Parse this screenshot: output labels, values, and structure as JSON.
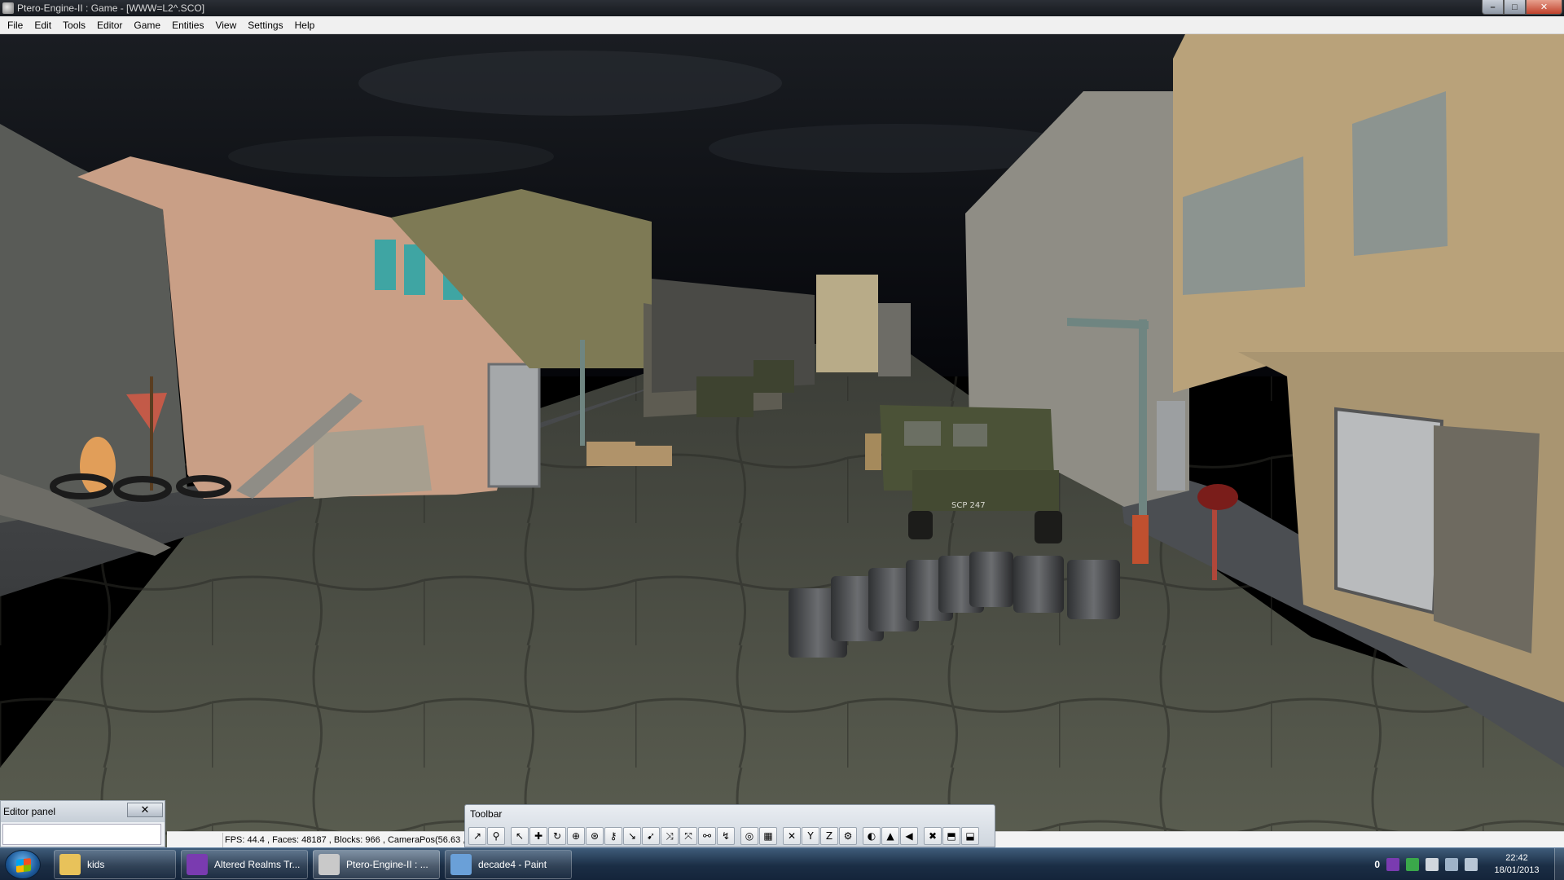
{
  "window": {
    "title": "Ptero-Engine-II : Game - [WWW=L2^.SCO]",
    "controls": {
      "minimize": "–",
      "maximize": "□",
      "close": "✕"
    }
  },
  "menu": {
    "items": [
      "File",
      "Edit",
      "Tools",
      "Editor",
      "Game",
      "Entities",
      "View",
      "Settings",
      "Help"
    ]
  },
  "editor_panel": {
    "title": "Editor panel",
    "close_label": "✕"
  },
  "toolbar": {
    "title": "Toolbar",
    "buttons": [
      "↗",
      "⚲",
      "↖",
      "✚",
      "↻",
      "⊕",
      "⊛",
      "⚷",
      "↘",
      "➹",
      "⤨",
      "⤧",
      "⚯",
      "↯",
      "◎",
      "▦",
      "✕",
      "Y",
      "Z",
      "⚙",
      "◐",
      "▲",
      "◀",
      "✖",
      "⬒",
      "⬓"
    ]
  },
  "status": {
    "text": "FPS: 44.4 , Faces: 48187 , Blocks: 966 , CameraPos(56.63 ,"
  },
  "viewport": {
    "truck_plate": "SCP 247"
  },
  "taskbar": {
    "items": [
      {
        "label": "kids",
        "icon": "folder-icon",
        "color": "#e8c25a"
      },
      {
        "label": "Altered Realms Tr...",
        "icon": "altered-realms-icon",
        "color": "#7a3bb0"
      },
      {
        "label": "Ptero-Engine-II : ...",
        "icon": "ptero-engine-icon",
        "color": "#c9c9c9"
      },
      {
        "label": "decade4 - Paint",
        "icon": "paint-icon",
        "color": "#6aa0d8"
      }
    ],
    "tray": {
      "badge": "0",
      "time": "22:42",
      "date": "18/01/2013"
    }
  }
}
